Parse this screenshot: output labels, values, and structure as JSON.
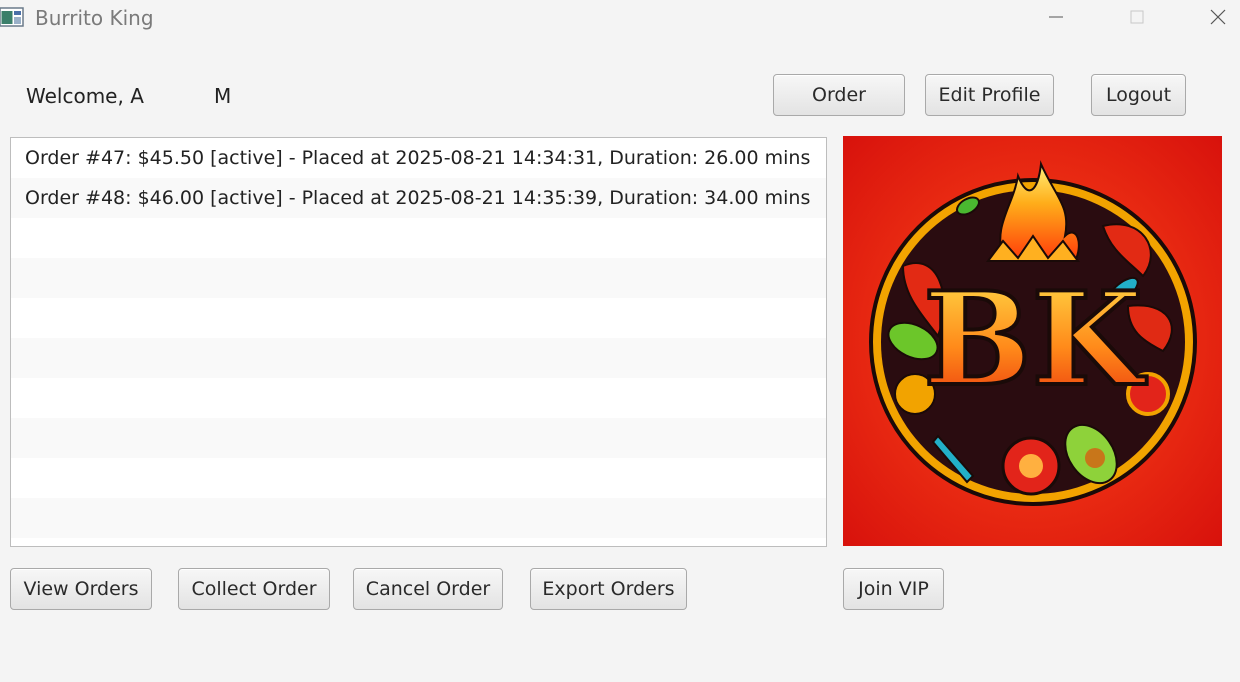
{
  "window": {
    "title": "Burrito King"
  },
  "header": {
    "welcome_label": "Welcome, A",
    "welcome_name": "M",
    "order_button": "Order",
    "edit_profile_button": "Edit Profile",
    "logout_button": "Logout"
  },
  "orders": [
    "Order #47: $45.50 [active] - Placed at 2025-08-21 14:34:31, Duration: 26.00 mins",
    "Order #48: $46.00 [active] - Placed at 2025-08-21 14:35:39, Duration: 34.00 mins"
  ],
  "logo": {
    "monogram": "BK",
    "background_color": "#e8190f",
    "ring_color": "#f5b400"
  },
  "actions": {
    "view_orders": "View Orders",
    "collect_order": "Collect Order",
    "cancel_order": "Cancel Order",
    "export_orders": "Export Orders",
    "join_vip": "Join VIP"
  }
}
